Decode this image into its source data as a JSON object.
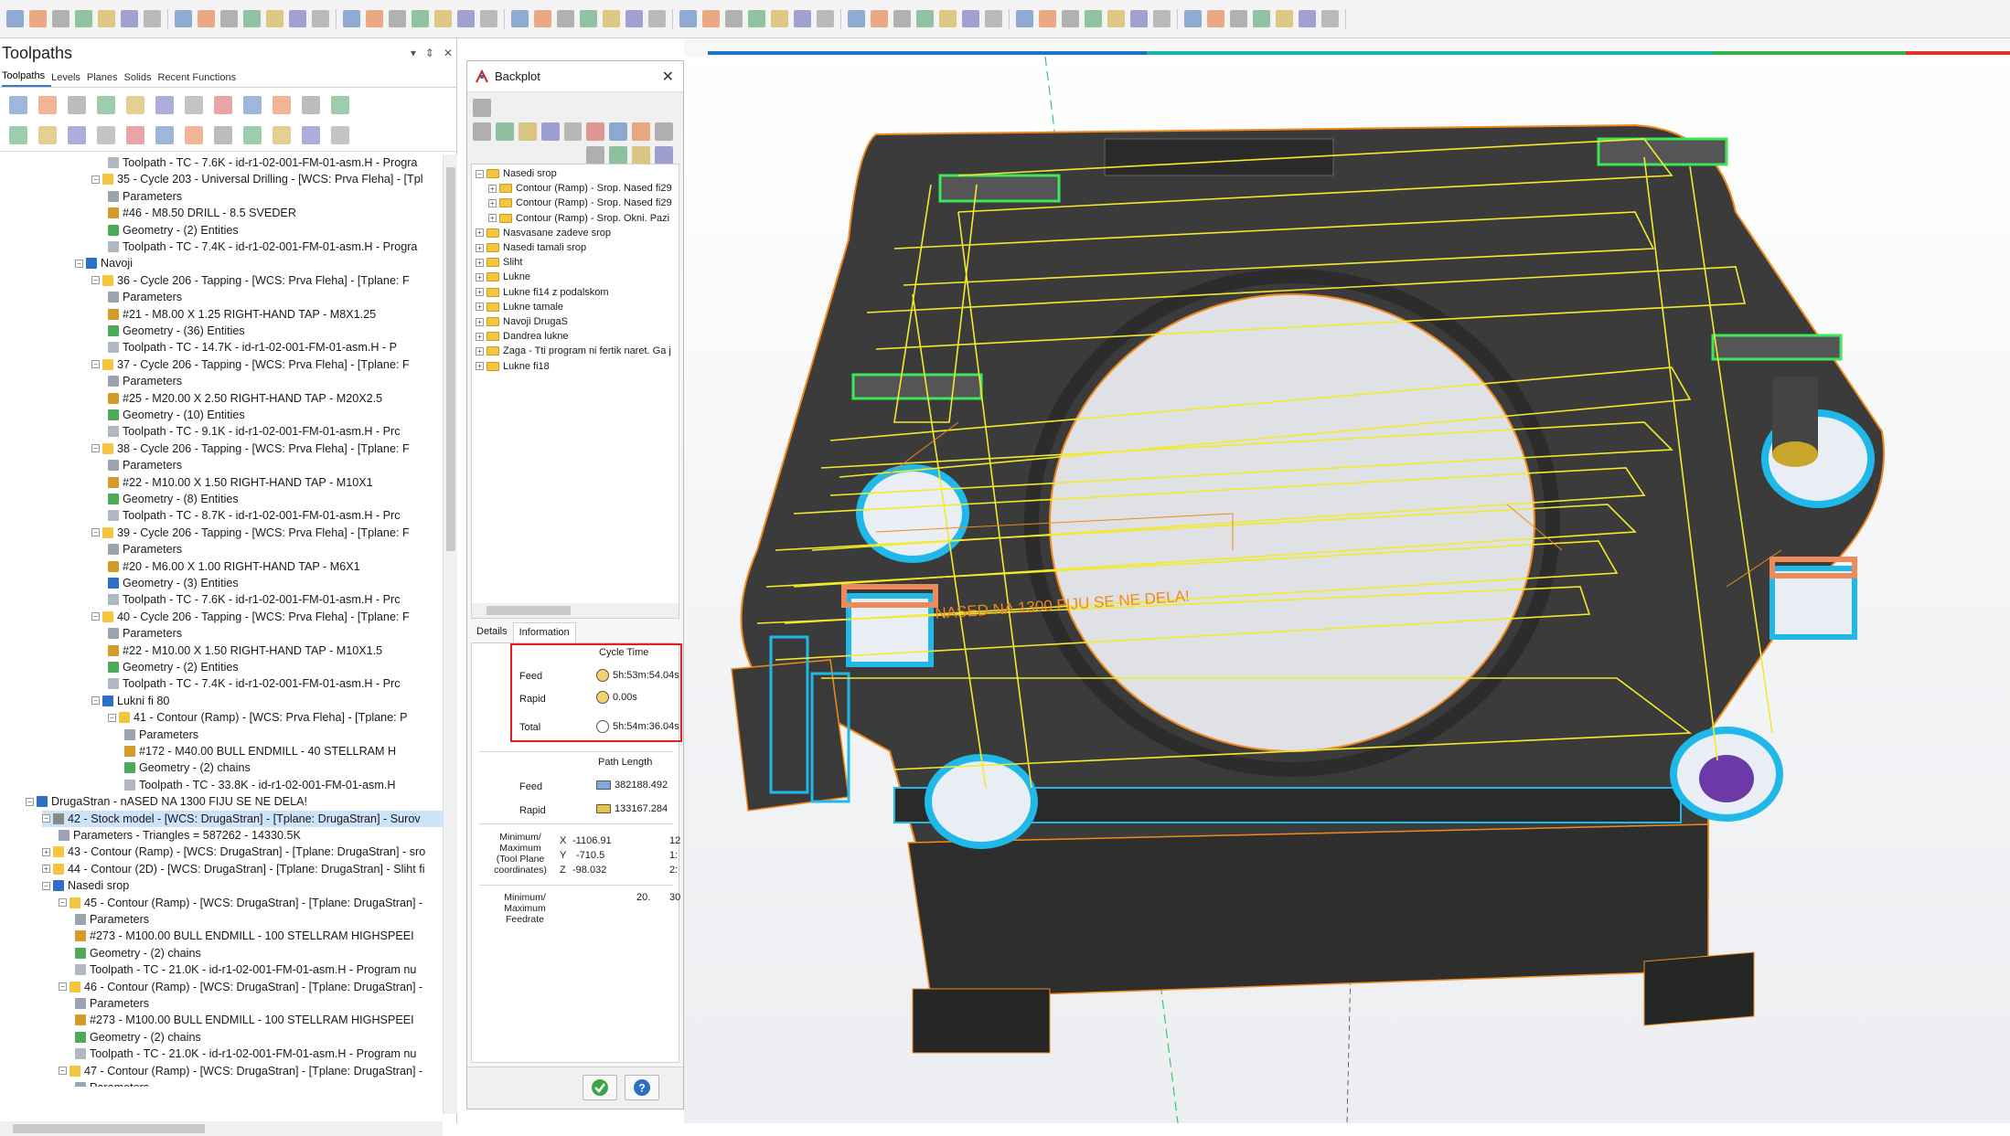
{
  "toolpaths_panel": {
    "title": "Toolpaths",
    "header_icons": [
      "▾",
      "⇕",
      "✕"
    ],
    "tabs": [
      "Toolpaths",
      "Levels",
      "Planes",
      "Solids",
      "Recent Functions"
    ],
    "tree": [
      {
        "indent": 6,
        "icon": "toolpath",
        "text": "Toolpath - TC - 7.6K - id-r1-02-001-FM-01-asm.H - Progra"
      },
      {
        "indent": 5,
        "icon": "folder",
        "exp": "−",
        "text": "35 - Cycle 203 - Universal Drilling - [WCS: Prva Fleha] - [Tpl"
      },
      {
        "indent": 6,
        "icon": "params",
        "text": "Parameters"
      },
      {
        "indent": 6,
        "icon": "tool",
        "text": "#46 - M8.50 DRILL - 8.5 SVEDER"
      },
      {
        "indent": 6,
        "icon": "geometry",
        "text": "Geometry - (2) Entities"
      },
      {
        "indent": 6,
        "icon": "toolpath",
        "text": "Toolpath - TC - 7.4K - id-r1-02-001-FM-01-asm.H - Progra"
      },
      {
        "indent": 4,
        "icon": "group",
        "exp": "−",
        "text": "Navoji"
      },
      {
        "indent": 5,
        "icon": "folder",
        "exp": "−",
        "text": "36 - Cycle 206 - Tapping - [WCS: Prva Fleha] - [Tplane: F"
      },
      {
        "indent": 6,
        "icon": "params",
        "text": "Parameters"
      },
      {
        "indent": 6,
        "icon": "tool",
        "text": "#21 - M8.00 X 1.25 RIGHT-HAND TAP - M8X1.25"
      },
      {
        "indent": 6,
        "icon": "geometry",
        "text": "Geometry - (36) Entities"
      },
      {
        "indent": 6,
        "icon": "toolpath",
        "text": "Toolpath - TC - 14.7K - id-r1-02-001-FM-01-asm.H - P"
      },
      {
        "indent": 5,
        "icon": "folder",
        "exp": "−",
        "text": "37 - Cycle 206 - Tapping - [WCS: Prva Fleha] - [Tplane: F"
      },
      {
        "indent": 6,
        "icon": "params",
        "text": "Parameters"
      },
      {
        "indent": 6,
        "icon": "tool",
        "text": "#25 - M20.00 X 2.50 RIGHT-HAND TAP - M20X2.5"
      },
      {
        "indent": 6,
        "icon": "geometry",
        "text": "Geometry - (10) Entities"
      },
      {
        "indent": 6,
        "icon": "toolpath",
        "text": "Toolpath - TC - 9.1K - id-r1-02-001-FM-01-asm.H - Prc"
      },
      {
        "indent": 5,
        "icon": "folder",
        "exp": "−",
        "text": "38 - Cycle 206 - Tapping - [WCS: Prva Fleha] - [Tplane: F"
      },
      {
        "indent": 6,
        "icon": "params",
        "text": "Parameters"
      },
      {
        "indent": 6,
        "icon": "tool",
        "text": "#22 - M10.00 X 1.50 RIGHT-HAND TAP - M10X1"
      },
      {
        "indent": 6,
        "icon": "geometry",
        "text": "Geometry - (8) Entities"
      },
      {
        "indent": 6,
        "icon": "toolpath",
        "text": "Toolpath - TC - 8.7K - id-r1-02-001-FM-01-asm.H - Prc"
      },
      {
        "indent": 5,
        "icon": "folder",
        "exp": "−",
        "text": "39 - Cycle 206 - Tapping - [WCS: Prva Fleha] - [Tplane: F"
      },
      {
        "indent": 6,
        "icon": "params",
        "text": "Parameters"
      },
      {
        "indent": 6,
        "icon": "tool",
        "text": "#20 - M6.00 X 1.00 RIGHT-HAND TAP - M6X1"
      },
      {
        "indent": 6,
        "icon": "geometry-blue",
        "text": "Geometry - (3) Entities"
      },
      {
        "indent": 6,
        "icon": "toolpath",
        "text": "Toolpath - TC - 7.6K - id-r1-02-001-FM-01-asm.H - Prc"
      },
      {
        "indent": 5,
        "icon": "folder",
        "exp": "−",
        "text": "40 - Cycle 206 - Tapping - [WCS: Prva Fleha] - [Tplane: F"
      },
      {
        "indent": 6,
        "icon": "params",
        "text": "Parameters"
      },
      {
        "indent": 6,
        "icon": "tool",
        "text": "#22 - M10.00 X 1.50 RIGHT-HAND TAP - M10X1.5"
      },
      {
        "indent": 6,
        "icon": "geometry",
        "text": "Geometry - (2) Entities"
      },
      {
        "indent": 6,
        "icon": "toolpath",
        "text": "Toolpath - TC - 7.4K - id-r1-02-001-FM-01-asm.H - Prc"
      },
      {
        "indent": 5,
        "icon": "group",
        "exp": "−",
        "text": "Lukni fi 80"
      },
      {
        "indent": 6,
        "icon": "folder",
        "exp": "−",
        "text": "41 - Contour (Ramp) - [WCS: Prva Fleha] - [Tplane: P"
      },
      {
        "indent": 7,
        "icon": "params",
        "text": "Parameters"
      },
      {
        "indent": 7,
        "icon": "tool",
        "text": "#172 - M40.00 BULL ENDMILL - 40 STELLRAM H"
      },
      {
        "indent": 7,
        "icon": "geometry",
        "text": "Geometry - (2) chains"
      },
      {
        "indent": 7,
        "icon": "toolpath",
        "text": "Toolpath - TC - 33.8K - id-r1-02-001-FM-01-asm.H"
      },
      {
        "indent": 1,
        "icon": "group",
        "exp": "−",
        "text": "DrugaStran - nASED NA 1300 FIJU SE NE DELA!"
      },
      {
        "indent": 2,
        "icon": "stock",
        "exp": "−",
        "text": "42 - Stock model - [WCS: DrugaStran] - [Tplane: DrugaStran] - Surov",
        "selected": true
      },
      {
        "indent": 3,
        "icon": "params",
        "text": "Parameters - Triangles =  587262 - 14330.5K"
      },
      {
        "indent": 2,
        "icon": "folder",
        "exp": "+",
        "text": "43 - Contour (Ramp) - [WCS: DrugaStran] - [Tplane: DrugaStran] - sro"
      },
      {
        "indent": 2,
        "icon": "folder",
        "exp": "+",
        "text": "44 - Contour (2D) - [WCS: DrugaStran] - [Tplane: DrugaStran] - Sliht fi"
      },
      {
        "indent": 2,
        "icon": "group",
        "exp": "−",
        "text": "Nasedi srop"
      },
      {
        "indent": 3,
        "icon": "folder",
        "exp": "−",
        "text": "45 - Contour (Ramp) - [WCS: DrugaStran] - [Tplane: DrugaStran] -"
      },
      {
        "indent": 4,
        "icon": "params",
        "text": "Parameters"
      },
      {
        "indent": 4,
        "icon": "tool",
        "text": "#273 - M100.00 BULL ENDMILL - 100 STELLRAM HIGHSPEEI"
      },
      {
        "indent": 4,
        "icon": "geometry",
        "text": "Geometry - (2) chains"
      },
      {
        "indent": 4,
        "icon": "toolpath",
        "text": "Toolpath - TC - 21.0K - id-r1-02-001-FM-01-asm.H - Program nu"
      },
      {
        "indent": 3,
        "icon": "folder",
        "exp": "−",
        "text": "46 - Contour (Ramp) - [WCS: DrugaStran] - [Tplane: DrugaStran] -"
      },
      {
        "indent": 4,
        "icon": "params",
        "text": "Parameters"
      },
      {
        "indent": 4,
        "icon": "tool",
        "text": "#273 - M100.00 BULL ENDMILL - 100 STELLRAM HIGHSPEEI"
      },
      {
        "indent": 4,
        "icon": "geometry",
        "text": "Geometry - (2) chains"
      },
      {
        "indent": 4,
        "icon": "toolpath",
        "text": "Toolpath - TC - 21.0K - id-r1-02-001-FM-01-asm.H - Program nu"
      },
      {
        "indent": 3,
        "icon": "folder",
        "exp": "−",
        "text": "47 - Contour (Ramp) - [WCS: DrugaStran] - [Tplane: DrugaStran] -"
      },
      {
        "indent": 4,
        "icon": "params",
        "text": "Parameters"
      }
    ]
  },
  "backplot": {
    "title": "Backplot",
    "tree": [
      {
        "indent": 0,
        "exp": "−",
        "text": "Nasedi srop"
      },
      {
        "indent": 1,
        "exp": "+",
        "text": "Contour (Ramp) - Srop. Nased fi29"
      },
      {
        "indent": 1,
        "exp": "+",
        "text": "Contour (Ramp) - Srop. Nased fi29"
      },
      {
        "indent": 1,
        "exp": "+",
        "text": "Contour (Ramp) - Srop. Okni. Pazi"
      },
      {
        "indent": 0,
        "exp": "+",
        "text": "Nasvasane zadeve srop"
      },
      {
        "indent": 0,
        "exp": "+",
        "text": "Nasedi tamali srop"
      },
      {
        "indent": 0,
        "exp": "+",
        "text": "Sliht"
      },
      {
        "indent": 0,
        "exp": "+",
        "text": "Lukne"
      },
      {
        "indent": 0,
        "exp": "+",
        "text": "Lukne fi14 z podalskom"
      },
      {
        "indent": 0,
        "exp": "+",
        "text": "Lukne tamale"
      },
      {
        "indent": 0,
        "exp": "+",
        "text": "Navoji DrugaS"
      },
      {
        "indent": 0,
        "exp": "+",
        "text": "Dandrea lukne"
      },
      {
        "indent": 0,
        "exp": "+",
        "text": "Zaga - Tti program ni fertik naret. Ga j"
      },
      {
        "indent": 0,
        "exp": "+",
        "text": "Lukne fi18"
      }
    ],
    "tabs": [
      "Details",
      "Information"
    ],
    "cycle_time": {
      "heading": "Cycle Time",
      "feed_label": "Feed",
      "feed_value": "5h:53m:54.04s",
      "rapid_label": "Rapid",
      "rapid_value": "0.00s",
      "total_label": "Total",
      "total_value": "5h:54m:36.04s"
    },
    "path_length": {
      "heading": "Path Length",
      "feed_label": "Feed",
      "feed_value": "382188.492",
      "rapid_label": "Rapid",
      "rapid_value": "133167.284"
    },
    "minmax": {
      "label_line1": "Minimum/",
      "label_line2": "Maximum",
      "label_line3": "(Tool Plane",
      "label_line4": "coordinates)",
      "x_label": "X",
      "x_min": "-1106.91",
      "x_max": "12",
      "y_label": "Y",
      "y_min": "-710.5",
      "y_max": "1:",
      "z_label": "Z",
      "z_min": "-98.032",
      "z_max": "2:"
    },
    "feedrate": {
      "label_line1": "Minimum/",
      "label_line2": "Maximum",
      "label_line3": "Feedrate",
      "min": "20.",
      "max": "30"
    }
  },
  "viewport": {
    "annotation": "NASED NA 1300 FIJU SE NE DELA!"
  },
  "colors": {
    "accent": "#1e73c8",
    "highlight_box": "#e02020",
    "part_body": "#3a3a3a",
    "toolpath_yellow": "#f2ea2c",
    "part_edge": "#f08a1c",
    "cyan": "#1fb8e8"
  }
}
